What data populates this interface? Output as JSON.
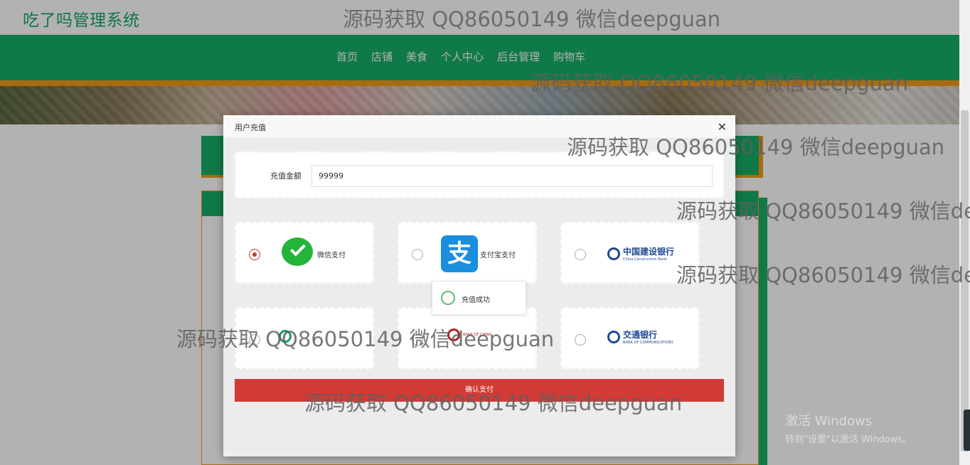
{
  "header": {
    "logo": "吃了吗管理系统"
  },
  "nav": {
    "items": [
      "首页",
      "店铺",
      "美食",
      "个人中心",
      "后台管理",
      "购物车"
    ]
  },
  "dialog": {
    "title": "用户充值",
    "close_icon": "close-icon",
    "amount_label": "充值金额",
    "amount_value": "99999",
    "payment_options": [
      {
        "name": "wechat",
        "label": "微信支付",
        "selected": true
      },
      {
        "name": "alipay",
        "label": "支付宝支付",
        "selected": false
      },
      {
        "name": "ccb",
        "label": "中国建设银行",
        "sub": "China Construction Bank",
        "selected": false
      },
      {
        "name": "abc",
        "label": "",
        "selected": false
      },
      {
        "name": "boc",
        "label": "",
        "sub": "BANK OF CHINA",
        "selected": false
      },
      {
        "name": "bocom",
        "label": "交通银行",
        "sub": "BANK OF COMMUNICATIONS",
        "selected": false
      }
    ],
    "toast": "充值成功",
    "confirm_label": "确认支付"
  },
  "watermark": "源码获取 QQ86050149 微信deepguan",
  "windows_activation": {
    "line1": "激活 Windows",
    "line2": "转到\"设置\"以激活 Windows。"
  },
  "colors": {
    "brand_green": "#17ae67",
    "accent_orange": "#f39a17",
    "confirm_red": "#d13b35"
  }
}
